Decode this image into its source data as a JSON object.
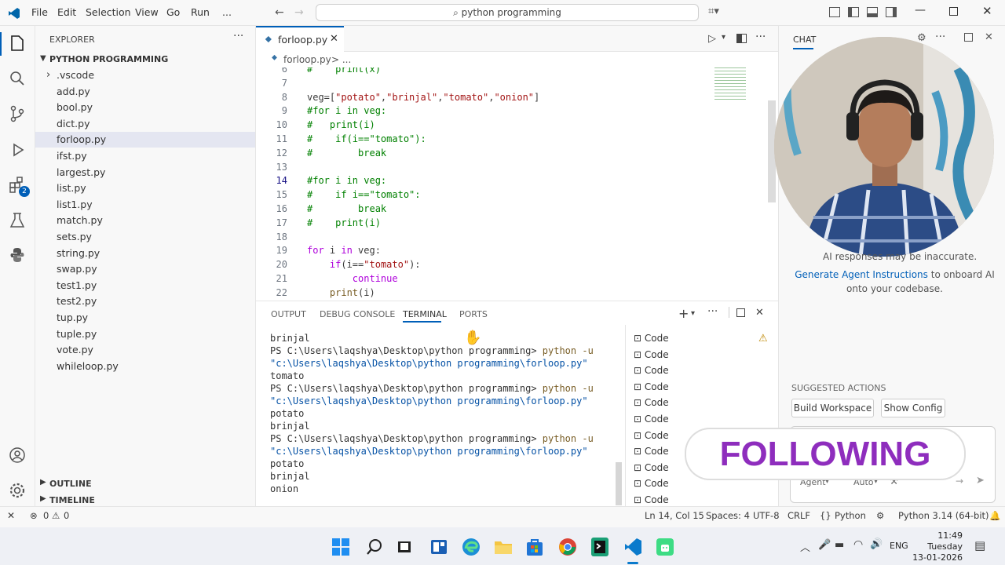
{
  "menu": [
    "File",
    "Edit",
    "Selection",
    "View",
    "Go",
    "Run",
    "..."
  ],
  "search": {
    "text": "python programming"
  },
  "explorer": {
    "title": "EXPLORER",
    "folder": "PYTHON PROGRAMMING",
    "items": [
      ".vscode",
      "add.py",
      "bool.py",
      "dict.py",
      "forloop.py",
      "ifst.py",
      "largest.py",
      "list.py",
      "list1.py",
      "match.py",
      "sets.py",
      "string.py",
      "swap.py",
      "test1.py",
      "test2.py",
      "tup.py",
      "tuple.py",
      "vote.py",
      "whileloop.py"
    ],
    "selected": "forloop.py",
    "outline": "OUTLINE",
    "timeline": "TIMELINE"
  },
  "activity_badge": "2",
  "editor": {
    "tab": "forloop.py",
    "breadcrumb_file": "forloop.py",
    "breadcrumb_rest": "> ...",
    "lines": [
      {
        "n": "6",
        "text": "#    print(x)"
      },
      {
        "n": "7",
        "text": ""
      },
      {
        "n": "8",
        "text": "veg=[\"potato\",\"brinjal\",\"tomato\",\"onion\"]"
      },
      {
        "n": "9",
        "text": "#for i in veg:"
      },
      {
        "n": "10",
        "text": "#   print(i)"
      },
      {
        "n": "11",
        "text": "#    if(i==\"tomato\"):"
      },
      {
        "n": "12",
        "text": "#        break"
      },
      {
        "n": "13",
        "text": ""
      },
      {
        "n": "14",
        "text": "#for i in veg:"
      },
      {
        "n": "15",
        "text": "#    if i==\"tomato\":"
      },
      {
        "n": "16",
        "text": "#        break"
      },
      {
        "n": "17",
        "text": "#    print(i)"
      },
      {
        "n": "18",
        "text": ""
      },
      {
        "n": "19",
        "text": "for i in veg:"
      },
      {
        "n": "20",
        "text": "    if(i==\"tomato\"):"
      },
      {
        "n": "21",
        "text": "        continue"
      },
      {
        "n": "22",
        "text": "    print(i)"
      }
    ]
  },
  "panel": {
    "tabs": [
      "OUTPUT",
      "DEBUG CONSOLE",
      "TERMINAL",
      "PORTS"
    ],
    "active": "TERMINAL",
    "terminal_lines": [
      {
        "text": "brinjal",
        "kind": "out"
      },
      {
        "prompt": "PS C:\\Users\\laqshya\\Desktop\\python programming> ",
        "cmd": "python -u",
        "kind": "cmd"
      },
      {
        "text": "\"c:\\Users\\laqshya\\Desktop\\python programming\\forloop.py\"",
        "kind": "path"
      },
      {
        "text": "tomato",
        "kind": "out"
      },
      {
        "prompt": "PS C:\\Users\\laqshya\\Desktop\\python programming> ",
        "cmd": "python -u",
        "kind": "cmd"
      },
      {
        "text": "\"c:\\Users\\laqshya\\Desktop\\python programming\\forloop.py\"",
        "kind": "path"
      },
      {
        "text": "potato",
        "kind": "out"
      },
      {
        "text": "brinjal",
        "kind": "out"
      },
      {
        "prompt": "PS C:\\Users\\laqshya\\Desktop\\python programming> ",
        "cmd": "python -u",
        "kind": "cmd"
      },
      {
        "text": "\"c:\\Users\\laqshya\\Desktop\\python programming\\forloop.py\"",
        "kind": "path"
      },
      {
        "text": "potato",
        "kind": "out"
      },
      {
        "text": "brinjal",
        "kind": "out"
      },
      {
        "text": "onion",
        "kind": "out"
      }
    ],
    "terminal_entries": [
      "Code",
      "Code",
      "Code",
      "Code",
      "Code",
      "Code",
      "Code",
      "Code",
      "Code",
      "Code",
      "Code"
    ]
  },
  "chat": {
    "title": "CHAT",
    "disclaimer": "AI responses may be inaccurate.",
    "link": "Generate Agent Instructions",
    "link_rest": "to onboard AI onto your codebase.",
    "suggested_title": "SUGGESTED ACTIONS",
    "actions": [
      "Build Workspace",
      "Show Config"
    ],
    "agent": "Agent",
    "model": "Auto"
  },
  "overlay": "FOLLOWING",
  "status": {
    "errors": "0",
    "warnings": "0",
    "position": "Ln 14, Col 15",
    "spaces": "Spaces: 4",
    "encoding": "UTF-8",
    "eol": "CRLF",
    "language": "Python",
    "interpreter": "Python 3.14 (64-bit)"
  },
  "taskbar": {
    "lang": "ENG",
    "time": "11:49",
    "day": "Tuesday",
    "date": "13-01-2026"
  }
}
